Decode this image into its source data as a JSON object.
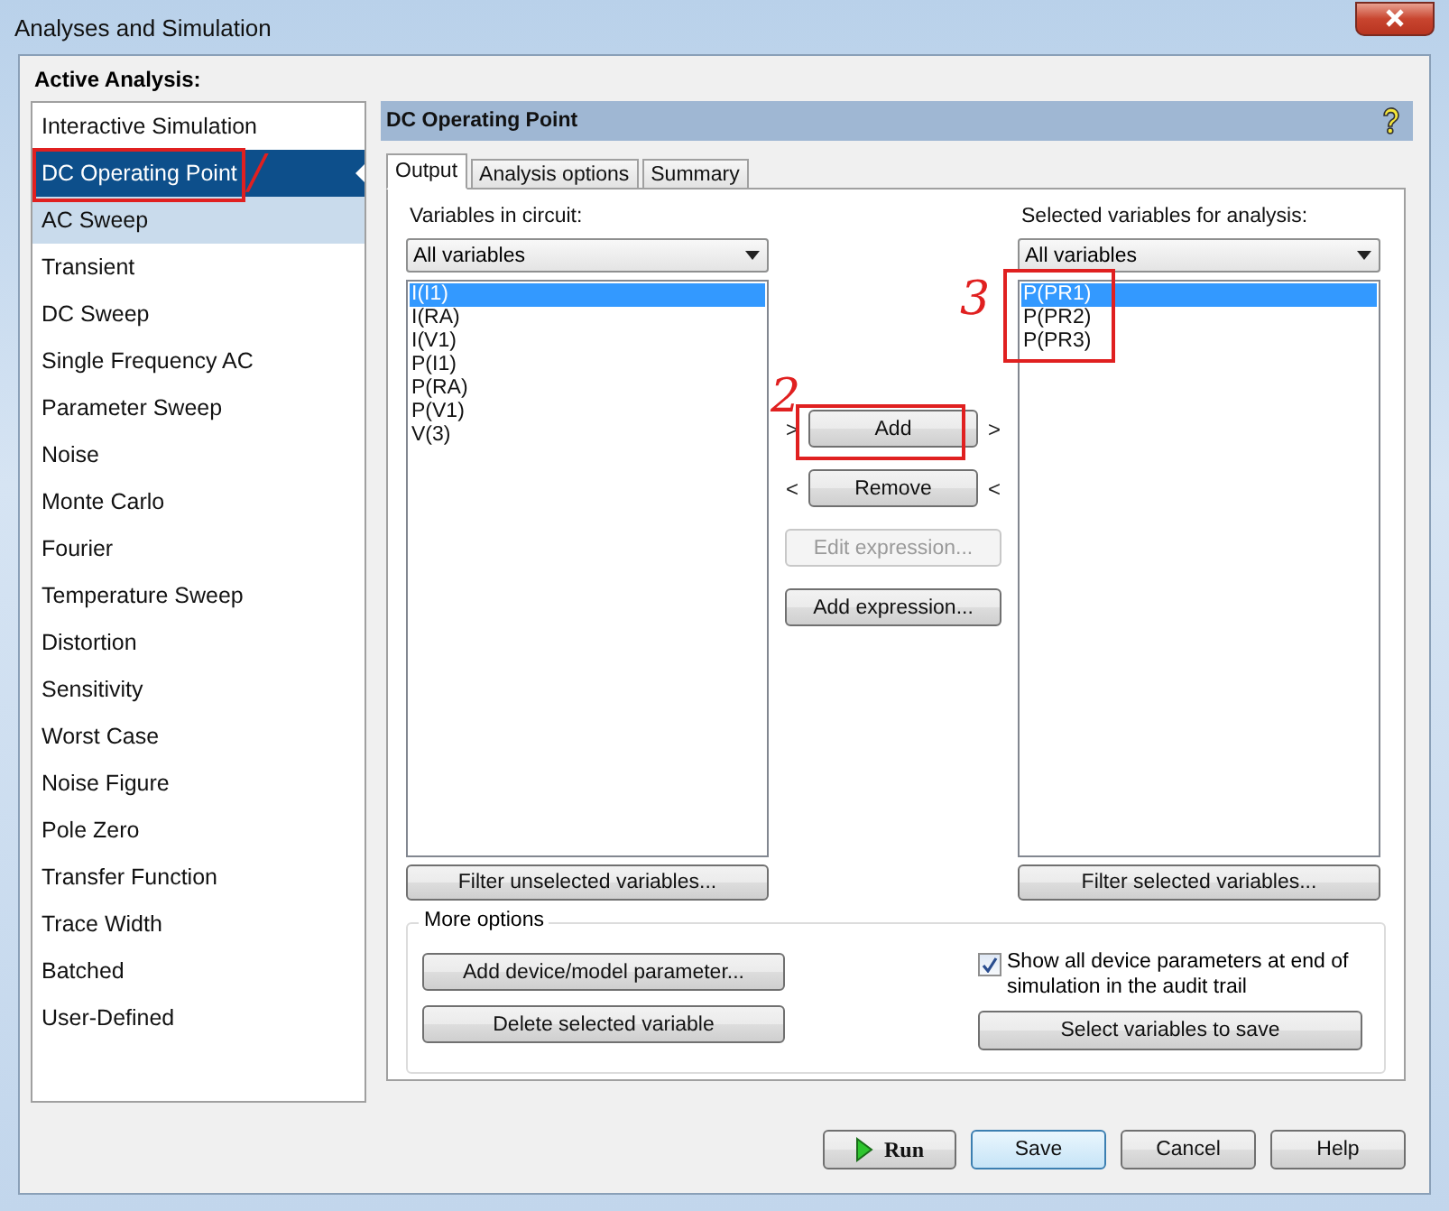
{
  "window": {
    "title": "Analyses and Simulation"
  },
  "active_analysis": {
    "label": "Active Analysis:"
  },
  "sidebar": {
    "items": [
      {
        "label": "Interactive Simulation",
        "selected": false,
        "highlighted": false
      },
      {
        "label": "DC Operating Point",
        "selected": true,
        "highlighted": false
      },
      {
        "label": "AC Sweep",
        "selected": false,
        "highlighted": true
      },
      {
        "label": "Transient",
        "selected": false,
        "highlighted": false
      },
      {
        "label": "DC Sweep",
        "selected": false,
        "highlighted": false
      },
      {
        "label": "Single Frequency AC",
        "selected": false,
        "highlighted": false
      },
      {
        "label": "Parameter Sweep",
        "selected": false,
        "highlighted": false
      },
      {
        "label": "Noise",
        "selected": false,
        "highlighted": false
      },
      {
        "label": "Monte Carlo",
        "selected": false,
        "highlighted": false
      },
      {
        "label": "Fourier",
        "selected": false,
        "highlighted": false
      },
      {
        "label": "Temperature Sweep",
        "selected": false,
        "highlighted": false
      },
      {
        "label": "Distortion",
        "selected": false,
        "highlighted": false
      },
      {
        "label": "Sensitivity",
        "selected": false,
        "highlighted": false
      },
      {
        "label": "Worst Case",
        "selected": false,
        "highlighted": false
      },
      {
        "label": "Noise Figure",
        "selected": false,
        "highlighted": false
      },
      {
        "label": "Pole Zero",
        "selected": false,
        "highlighted": false
      },
      {
        "label": "Transfer Function",
        "selected": false,
        "highlighted": false
      },
      {
        "label": "Trace Width",
        "selected": false,
        "highlighted": false
      },
      {
        "label": "Batched",
        "selected": false,
        "highlighted": false
      },
      {
        "label": "User-Defined",
        "selected": false,
        "highlighted": false
      }
    ]
  },
  "panel": {
    "title": "DC Operating Point"
  },
  "tabs": [
    {
      "label": "Output",
      "selected": true
    },
    {
      "label": "Analysis options",
      "selected": false
    },
    {
      "label": "Summary",
      "selected": false
    }
  ],
  "variables_in_circuit": {
    "label": "Variables in circuit:",
    "filter": "All variables",
    "filter_button": "Filter unselected variables...",
    "items": [
      {
        "label": "I(I1)",
        "selected": true
      },
      {
        "label": "I(RA)",
        "selected": false
      },
      {
        "label": "I(V1)",
        "selected": false
      },
      {
        "label": "P(I1)",
        "selected": false
      },
      {
        "label": "P(RA)",
        "selected": false
      },
      {
        "label": "P(V1)",
        "selected": false
      },
      {
        "label": "V(3)",
        "selected": false
      }
    ]
  },
  "middle_buttons": [
    {
      "kind": "move",
      "label": "Add",
      "arrows": [
        ">",
        ">"
      ],
      "disabled": false
    },
    {
      "kind": "move",
      "label": "Remove",
      "arrows": [
        "<",
        "<"
      ],
      "disabled": false
    },
    {
      "kind": "plain",
      "label": "Edit expression...",
      "disabled": true
    },
    {
      "kind": "plain",
      "label": "Add expression...",
      "disabled": false
    }
  ],
  "selected_variables": {
    "label": "Selected variables for analysis:",
    "filter": "All variables",
    "filter_button": "Filter selected variables...",
    "items": [
      {
        "label": "P(PR1)",
        "selected": true
      },
      {
        "label": "P(PR2)",
        "selected": false
      },
      {
        "label": "P(PR3)",
        "selected": false
      }
    ]
  },
  "more_options": {
    "title": "More options",
    "buttons": [
      "Add device/model parameter...",
      "Delete selected variable"
    ],
    "checkbox": {
      "label": "Show all device parameters at end of simulation in the audit trail",
      "checked": true
    },
    "save_button": "Select variables to save"
  },
  "footer_buttons": [
    {
      "kind": "run",
      "label": "Run",
      "default": false
    },
    {
      "kind": "plain",
      "label": "Save",
      "default": true
    },
    {
      "kind": "plain",
      "label": "Cancel",
      "default": false
    },
    {
      "kind": "plain",
      "label": "Help",
      "default": false
    }
  ],
  "annotations": [
    {
      "label": "/"
    },
    {
      "label": "2"
    },
    {
      "label": "3"
    }
  ]
}
